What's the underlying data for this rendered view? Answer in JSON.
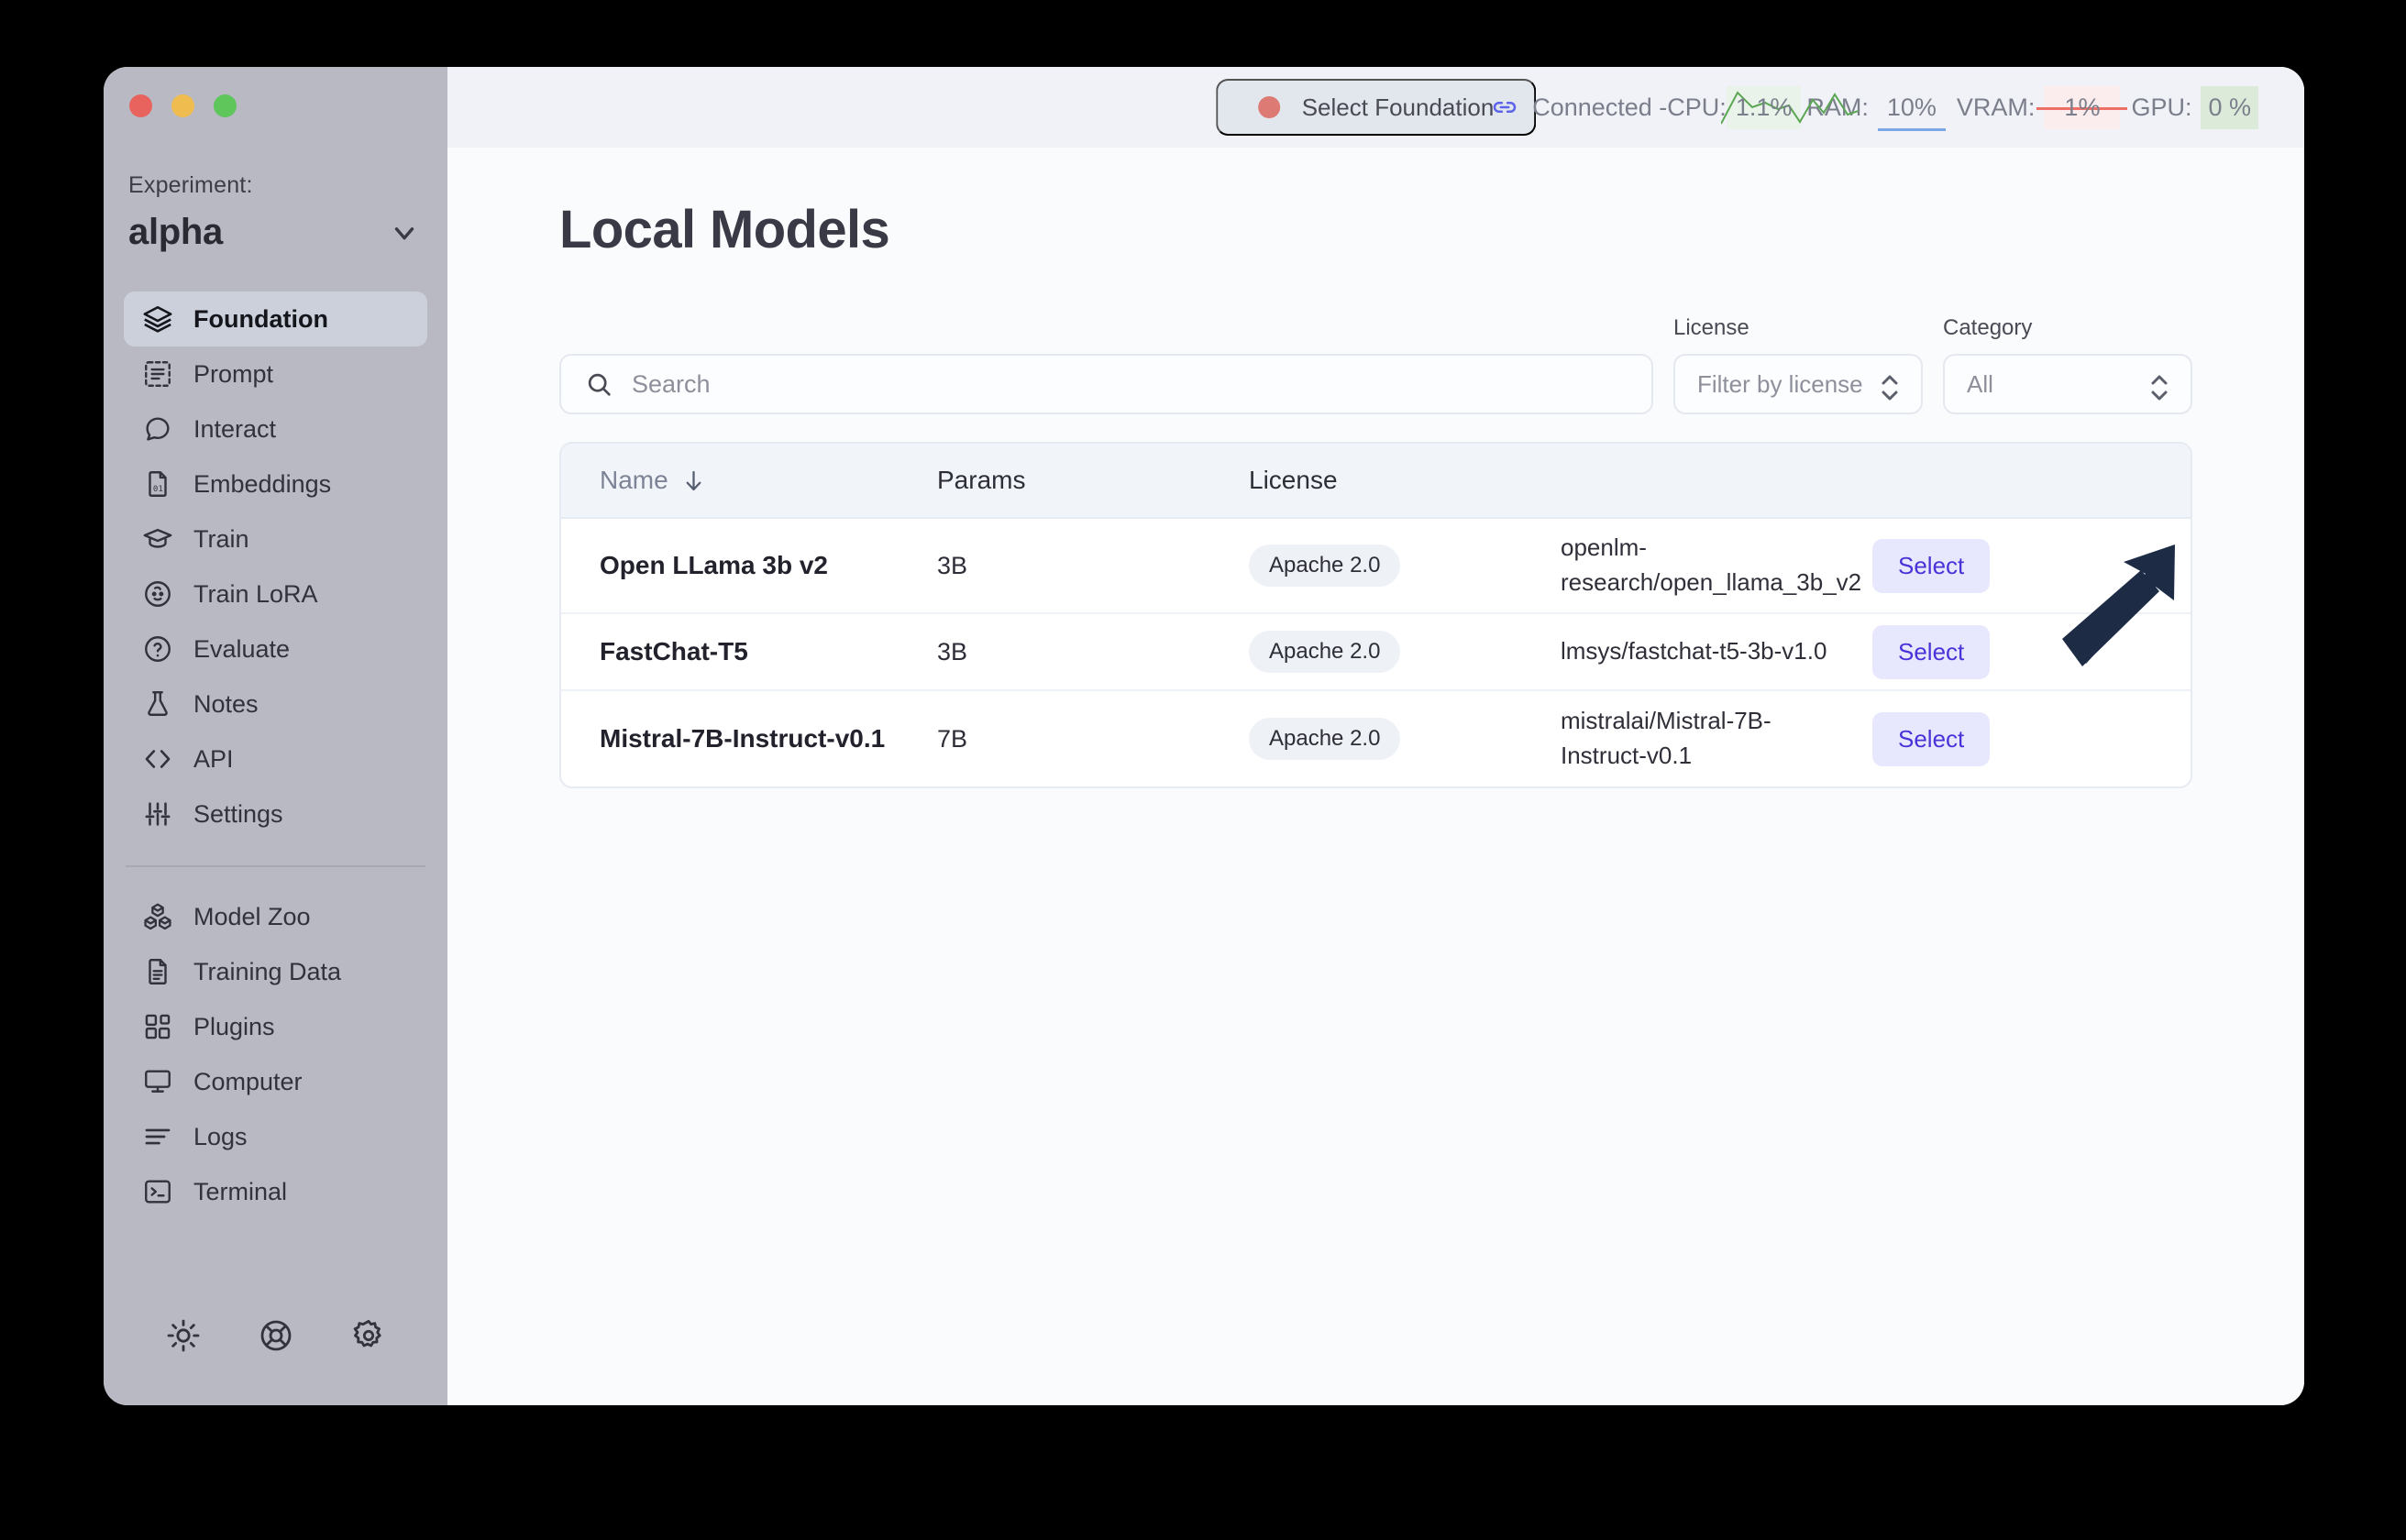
{
  "window": {
    "traffic_lights": [
      "close",
      "minimize",
      "maximize"
    ]
  },
  "sidebar": {
    "experiment_label": "Experiment:",
    "experiment_value": "alpha",
    "items": [
      {
        "label": "Foundation",
        "icon": "layers-icon",
        "active": true
      },
      {
        "label": "Prompt",
        "icon": "prompt-icon",
        "active": false
      },
      {
        "label": "Interact",
        "icon": "chat-icon",
        "active": false
      },
      {
        "label": "Embeddings",
        "icon": "binary-file-icon",
        "active": false
      },
      {
        "label": "Train",
        "icon": "graduation-cap-icon",
        "active": false
      },
      {
        "label": "Train LoRA",
        "icon": "baby-face-icon",
        "active": false
      },
      {
        "label": "Evaluate",
        "icon": "question-circle-icon",
        "active": false
      },
      {
        "label": "Notes",
        "icon": "flask-icon",
        "active": false
      },
      {
        "label": "API",
        "icon": "code-brackets-icon",
        "active": false
      },
      {
        "label": "Settings",
        "icon": "sliders-icon",
        "active": false
      }
    ],
    "secondary_items": [
      {
        "label": "Model Zoo",
        "icon": "cubes-icon"
      },
      {
        "label": "Training Data",
        "icon": "document-lines-icon"
      },
      {
        "label": "Plugins",
        "icon": "plugin-blocks-icon"
      },
      {
        "label": "Computer",
        "icon": "monitor-icon"
      },
      {
        "label": "Logs",
        "icon": "list-lines-icon"
      },
      {
        "label": "Terminal",
        "icon": "terminal-icon"
      }
    ],
    "footer_icons": [
      {
        "name": "brightness-icon"
      },
      {
        "name": "lifebuoy-icon"
      },
      {
        "name": "gear-icon"
      }
    ]
  },
  "topbar": {
    "foundation_pill_label": "Select Foundation",
    "foundation_pill_dot_color": "#dd7a73",
    "connection": {
      "link_icon": "link-icon",
      "status_text": "Connected - ",
      "cpu_label": "CPU:",
      "cpu_value": "1.1%",
      "ram_label": "RAM:",
      "ram_value": "10%",
      "vram_label": "VRAM:",
      "vram_value": "1%",
      "gpu_label": "GPU:",
      "gpu_value": "0 %"
    }
  },
  "main": {
    "page_title": "Local Models",
    "search": {
      "placeholder": "Search",
      "value": "",
      "icon": "search-icon"
    },
    "filters": [
      {
        "label": "License",
        "value": "Filter by license",
        "name": "license-select"
      },
      {
        "label": "Category",
        "value": "All",
        "name": "category-select"
      }
    ],
    "table": {
      "columns": [
        {
          "key": "name",
          "label": "Name",
          "sorted": true,
          "sort_dir": "desc"
        },
        {
          "key": "params",
          "label": "Params",
          "sorted": false
        },
        {
          "key": "license",
          "label": "License",
          "sorted": false
        },
        {
          "key": "repo",
          "label": "",
          "sorted": false
        },
        {
          "key": "action",
          "label": "",
          "sorted": false
        }
      ],
      "rows": [
        {
          "name": "Open LLama 3b v2",
          "params": "3B",
          "license": "Apache 2.0",
          "repo": "openlm-research/open_llama_3b_v2",
          "action_label": "Select"
        },
        {
          "name": "FastChat-T5",
          "params": "3B",
          "license": "Apache 2.0",
          "repo": "lmsys/fastchat-t5-3b-v1.0",
          "action_label": "Select"
        },
        {
          "name": "Mistral-7B-Instruct-v0.1",
          "params": "7B",
          "license": "Apache 2.0",
          "repo": "mistralai/Mistral-7B-Instruct-v0.1",
          "action_label": "Select"
        }
      ]
    }
  },
  "annotation": {
    "arrow_color": "#1d2c44",
    "points_to": "Select button on first row"
  },
  "colors": {
    "sidebar_bg": "#b9b9c4",
    "sidebar_active": "#ccd0da",
    "topbar_bg": "#f0f2f7",
    "content_bg": "#fafbfd",
    "select_button_bg": "#e7e8fd",
    "select_button_text": "#4b32d8",
    "badge_bg": "#eef1f6",
    "cpu_accent": "#5aa653",
    "ram_accent": "#7ba7e8",
    "vram_accent": "#ed6f66",
    "gpu_accent": "#dbead9"
  }
}
